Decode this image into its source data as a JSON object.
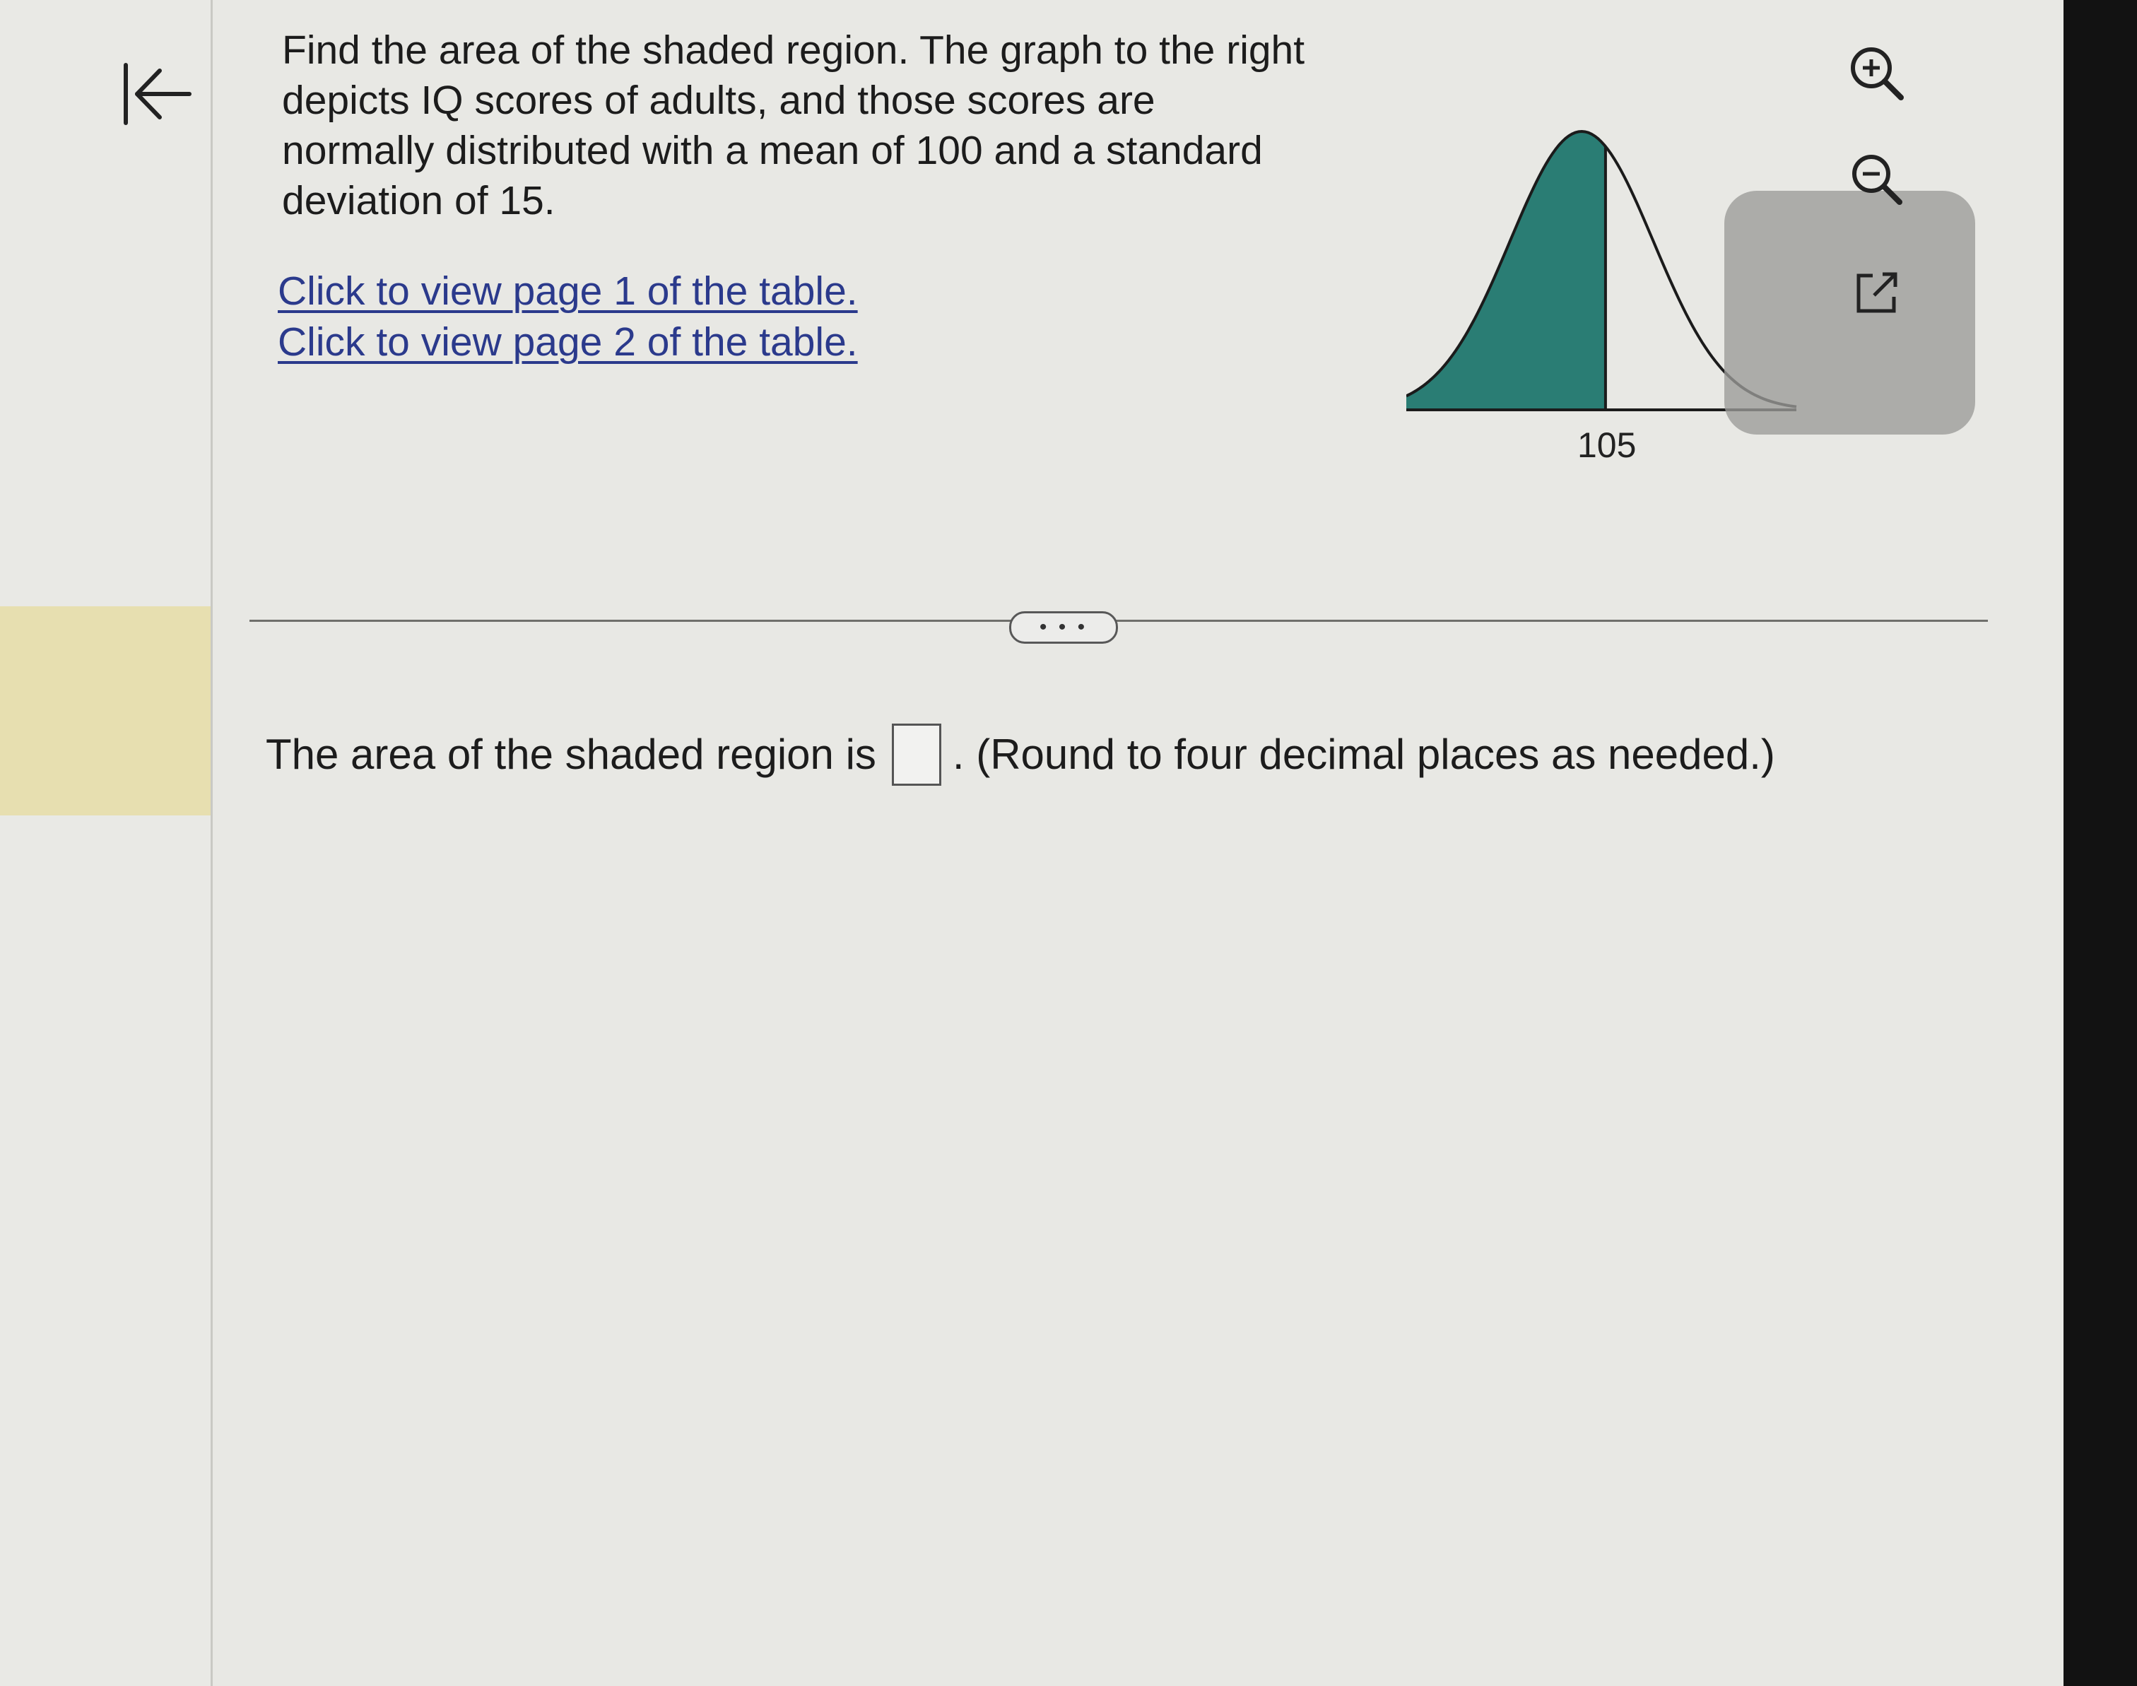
{
  "question": {
    "text": "Find the area of the shaded region. The graph to the right depicts IQ scores of adults, and those scores are normally distributed with a mean of 100 and a standard deviation of 15.",
    "links": [
      "Click to view page 1 of the table.",
      "Click to view page 2 of the table."
    ]
  },
  "graph": {
    "marker_label": "105",
    "mean": 100,
    "std_dev": 15,
    "shaded_region": "left of 105",
    "fill_color": "#2a7d74"
  },
  "toolbar": {
    "icons": [
      "zoom-in-icon",
      "zoom-out-icon",
      "popout-icon"
    ]
  },
  "separator": {
    "more_label": "• • •"
  },
  "answer": {
    "prefix": "The area of the shaded region is",
    "suffix": ". (Round to four decimal places as needed.)",
    "value": ""
  },
  "nav": {
    "collapse_icon": "collapse-left-icon"
  }
}
